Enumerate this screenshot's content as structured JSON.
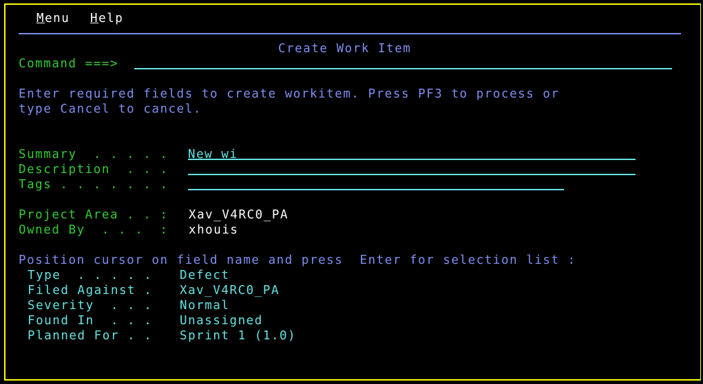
{
  "menubar": {
    "items": [
      {
        "label_first": "M",
        "label_rest": "enu"
      },
      {
        "label_first": "H",
        "label_rest": "elp"
      }
    ]
  },
  "panel": {
    "title": "Create Work Item",
    "command_label": "Command ===>",
    "command_value": ""
  },
  "instructions": {
    "line1": "Enter required fields to create workitem. Press PF3 to process or",
    "line2": "type Cancel to cancel."
  },
  "fields": {
    "summary": {
      "label": "Summary  . . . . .",
      "value": "New wi"
    },
    "description": {
      "label": "Description  . . .",
      "value": ""
    },
    "tags": {
      "label": "Tags . . . . . . .",
      "value": ""
    },
    "project_area": {
      "label": "Project Area . . :",
      "value": "Xav_V4RC0_PA"
    },
    "owned_by": {
      "label": "Owned By  . . .  :",
      "value": "xhouis"
    }
  },
  "selection": {
    "prompt": "Position cursor on field name and press  Enter for selection list :",
    "items": [
      {
        "label": "Type  . . . . .",
        "value": "Defect"
      },
      {
        "label": "Filed Against .",
        "value": "Xav_V4RC0_PA"
      },
      {
        "label": "Severity  . . .",
        "value": "Normal"
      },
      {
        "label": "Found In  . . .",
        "value": "Unassigned"
      },
      {
        "label": "Planned For . .",
        "value": "Sprint 1 (1.0)"
      }
    ]
  },
  "colors": {
    "border": "#ffff00",
    "label_green": "#33cc33",
    "text_blue": "#7f8ff0",
    "field_cyan": "#66e3e3",
    "value_white": "#ffffff"
  }
}
